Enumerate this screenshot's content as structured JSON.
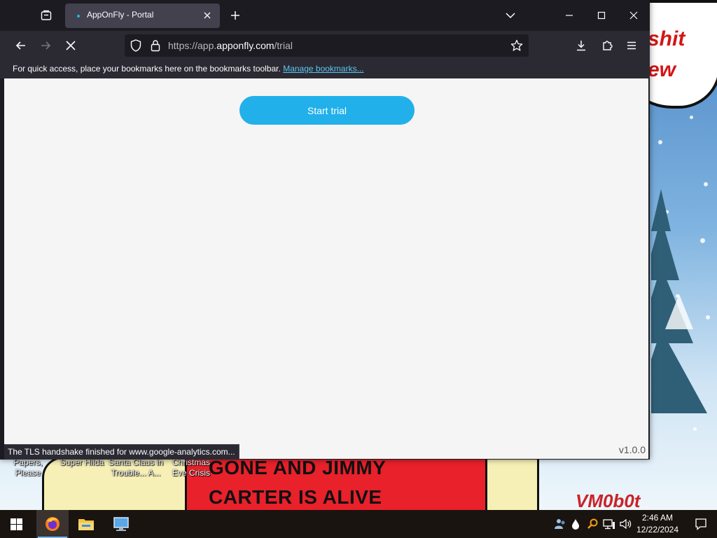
{
  "browser": {
    "tab_title": "AppOnFly - Portal",
    "url_prefix": "https://app.",
    "url_host": "apponfly.com",
    "url_path": "/trial",
    "bookmarks_message": "For quick access, place your bookmarks here on the bookmarks toolbar.",
    "bookmarks_link": "Manage bookmarks...",
    "status_text": "The TLS handshake finished for www.google-analytics.com..."
  },
  "page": {
    "start_trial_label": "Start trial",
    "version": "v1.0.0"
  },
  "desktop": {
    "bubble_line1": "shit",
    "bubble_line2": "ew",
    "poster_line1": "GONE AND JIMMY",
    "poster_line2": "CARTER IS ALIVE",
    "watermark": "VM0b0t",
    "icons": [
      {
        "label": "Papers, Please"
      },
      {
        "label": "Super Hilda"
      },
      {
        "label": "Santa Claus in Trouble... A..."
      },
      {
        "label": "Christmas Eve Crisis"
      }
    ]
  },
  "taskbar": {
    "time": "2:46 AM",
    "date": "12/22/2024"
  },
  "colors": {
    "accent": "#21b0ea",
    "browser_dark": "#1c1b22",
    "link": "#58c7f3"
  }
}
